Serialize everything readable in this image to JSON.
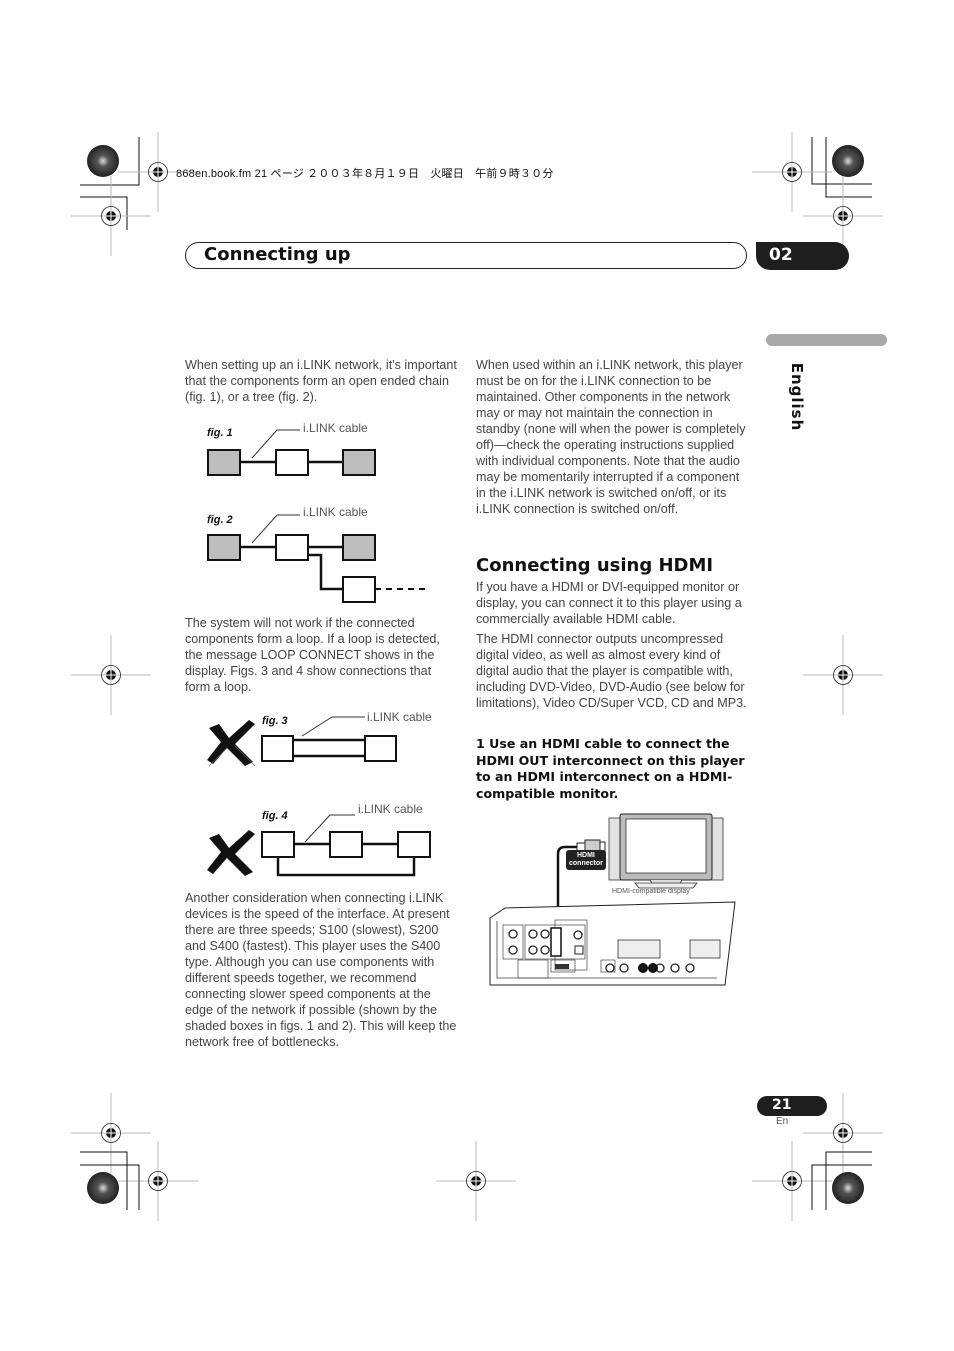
{
  "print_header": "868en.book.fm  21 ページ  ２００３年８月１９日　火曜日　午前９時３０分",
  "section": {
    "title": "Connecting up",
    "chapter": "02"
  },
  "side_tab": {
    "language": "English"
  },
  "left_column": {
    "intro": "When setting up an i.LINK network, it's important that the components form an open ended chain (fig. 1), or a tree (fig. 2).",
    "loop_warning": "The system will not work if the connected components form a loop. If a loop is detected, the message LOOP CONNECT shows in the display. Figs. 3 and 4 show connections that form a loop.",
    "speed_note": "Another consideration when connecting i.LINK devices is the speed of the interface. At present there are three speeds; S100 (slowest), S200 and S400 (fastest). This player uses the S400 type. Although you can use components with different speeds together, we recommend connecting slower speed components at the edge of the network if possible (shown by the shaded boxes in figs. 1 and 2). This will keep the network free of bottlenecks."
  },
  "figures": [
    {
      "label": "fig. 1",
      "cable_label": "i.LINK cable",
      "valid": true
    },
    {
      "label": "fig. 2",
      "cable_label": "i.LINK cable",
      "valid": true
    },
    {
      "label": "fig. 3",
      "cable_label": "i.LINK cable",
      "valid": false
    },
    {
      "label": "fig. 4",
      "cable_label": "i.LINK cable",
      "valid": false
    }
  ],
  "right_column": {
    "standby_note": "When used within an i.LINK network, this player must be on for the i.LINK connection to be maintained. Other components in the network may or may not maintain the connection in standby (none will when the power is completely off)—check the operating instructions supplied with individual components. Note that the audio may be momentarily interrupted if a component in the i.LINK network is switched on/off, or its i.LINK connection is switched on/off.",
    "heading": "Connecting using HDMI",
    "hdmi_intro": "If you have a HDMI or DVI-equipped monitor or display, you can connect it to this player using a commercially available HDMI cable.",
    "hdmi_detail": "The HDMI connector outputs uncompressed digital video, as well as almost every kind of digital audio that the player is compatible with, including DVD-Video, DVD-Audio (see below for limitations), Video CD/Super VCD, CD and MP3.",
    "step": "1    Use an HDMI cable to connect the HDMI OUT interconnect on this player to an HDMI interconnect on a HDMI-compatible monitor."
  },
  "illustration": {
    "connector_tag_line1": "HDMI",
    "connector_tag_line2": "connector",
    "display_caption": "HDMI-compatible display"
  },
  "footer": {
    "page_number": "21",
    "page_lang": "En"
  },
  "colors": {
    "shaded_box": "#bdbdbd",
    "dark_pill": "#1e1e1e",
    "lang_bar": "#a9a9a9"
  }
}
